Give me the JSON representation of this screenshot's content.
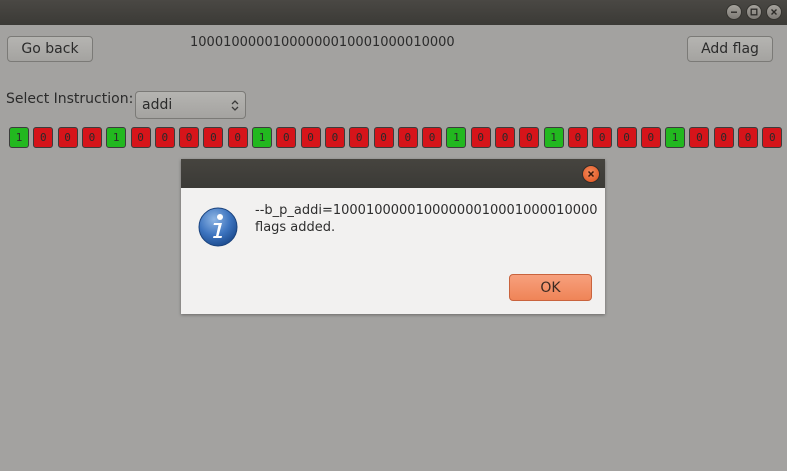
{
  "window": {
    "controls": [
      "minimize-icon",
      "maximize-icon",
      "close-icon"
    ]
  },
  "toolbar": {
    "go_back_label": "Go back",
    "add_flag_label": "Add flag",
    "binary_string": "10001000001000000010001000010000"
  },
  "instruction": {
    "label": "Select Instruction:",
    "selected": "addi"
  },
  "bits": [
    "1",
    "0",
    "0",
    "0",
    "1",
    "0",
    "0",
    "0",
    "0",
    "0",
    "1",
    "0",
    "0",
    "0",
    "0",
    "0",
    "0",
    "0",
    "1",
    "0",
    "0",
    "0",
    "1",
    "0",
    "0",
    "0",
    "0",
    "1",
    "0",
    "0",
    "0",
    "0"
  ],
  "colors": {
    "bit_on": "#22b81f",
    "bit_off": "#d6141a",
    "accent": "#ef8457"
  },
  "dialog": {
    "icon": "info-icon",
    "message_line1": "--b_p_addi=10001000001000000010001000010000",
    "message_line2": "flags added.",
    "ok_label": "OK"
  }
}
